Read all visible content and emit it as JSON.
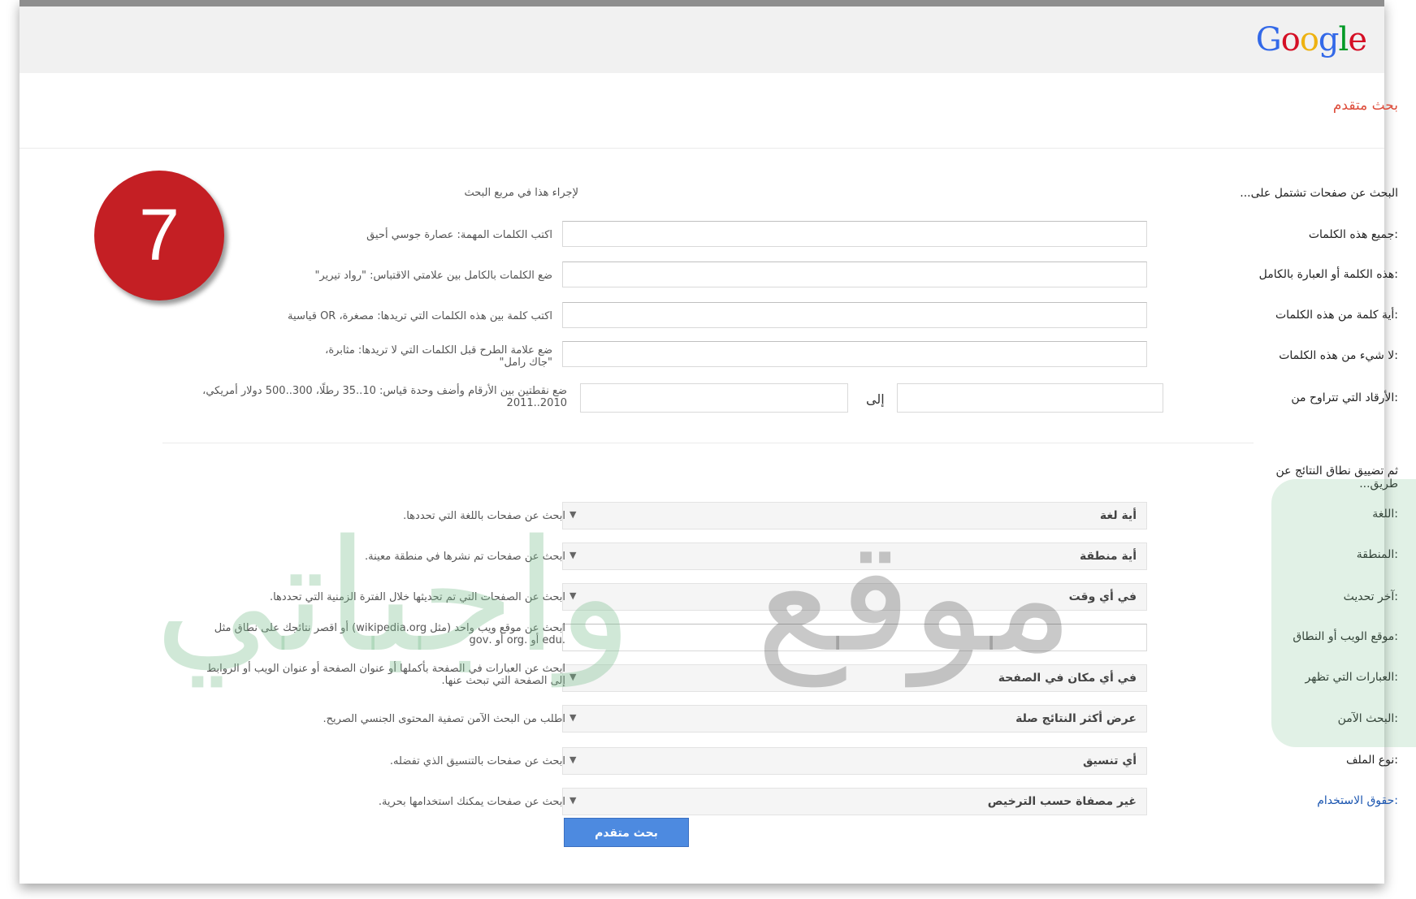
{
  "header": {
    "logo_letters": [
      {
        "ch": "G",
        "color": "#3369e8"
      },
      {
        "ch": "o",
        "color": "#d50f25"
      },
      {
        "ch": "o",
        "color": "#eeb211"
      },
      {
        "ch": "g",
        "color": "#3369e8"
      },
      {
        "ch": "l",
        "color": "#009925"
      },
      {
        "ch": "e",
        "color": "#d50f25"
      }
    ],
    "page_title": "بحث متقدم"
  },
  "badge": {
    "number": "7"
  },
  "find_section": {
    "title": "البحث عن صفحات تشتمل على...",
    "hint_header": "لإجراء هذا في مربع البحث",
    "rows": [
      {
        "label": "جميع هذه الكلمات:",
        "hint": "اكتب الكلمات المهمة: عصارة جوسي أحيق"
      },
      {
        "label": "هذه الكلمة أو العبارة بالكامل:",
        "hint": "ضع الكلمات بالكامل بين علامتي الاقتباس: \"رواد تيرير\""
      },
      {
        "label": "أية كلمة من هذه الكلمات:",
        "hint": "اكتب كلمة بين هذه الكلمات التي تريدها: مصغرة، OR قياسية"
      },
      {
        "label": "لا شيء من هذه الكلمات:",
        "hint": "ضع علامة الطرح قبل الكلمات التي لا تريدها: مثابرة، \"جاك رامل\""
      },
      {
        "label": "الأرقاد التي تتراوح من:",
        "hint": "ضع نقطتين بين الأرقام وأضف وحدة قياس: 10..35 رطلًا، 300..500 دولار أمريكي، 2010..2011"
      }
    ],
    "to_label": "إلى"
  },
  "narrow_section": {
    "title": "ثم تضييق نطاق النتائج عن طريق...",
    "rows": [
      {
        "label": "اللغة:",
        "value": "أية لغة",
        "hint": "ابحث عن صفحات باللغة التي تحددها."
      },
      {
        "label": "المنطقة:",
        "value": "أية منطقة",
        "hint": "ابحث عن صفحات تم نشرها في منطقة معينة."
      },
      {
        "label": "آخر تحديث:",
        "value": "في أي وقت",
        "hint": "ابحث عن الصفحات التي تم تحديثها خلال الفترة الزمنية التي تحددها."
      },
      {
        "label": "موقع الويب أو النطاق:",
        "value": "",
        "hint": "ابحث عن موقع ويب واحد (مثل wikipedia.org) أو اقصر نتائجك على نطاق مثل .edu أو .org أو .gov"
      },
      {
        "label": "العبارات التي تظهر:",
        "value": "في أي مكان في الصفحة",
        "hint": "ابحث عن العبارات في الصفحة بأكملها أو عنوان الصفحة أو عنوان الويب أو الروابط إلى الصفحة التي تبحث عنها."
      },
      {
        "label": "البحث الآمن:",
        "value": "عرض أكثر النتائج صلة",
        "hint": "اطلب من البحث الآمن تصفية المحتوى الجنسي الصريح."
      },
      {
        "label": "نوع الملف:",
        "value": "أي تنسيق",
        "hint": "ابحث عن صفحات بالتنسيق الذي تفضله."
      },
      {
        "label": "حقوق الاستخدام:",
        "value": "غير مصفاة حسب الترخيص",
        "hint": "ابحث عن صفحات يمكنك استخدامها بحرية."
      }
    ]
  },
  "submit_label": "بحث متقدم",
  "watermark": {
    "part1": "واجباتي",
    "part2": "موقع"
  }
}
